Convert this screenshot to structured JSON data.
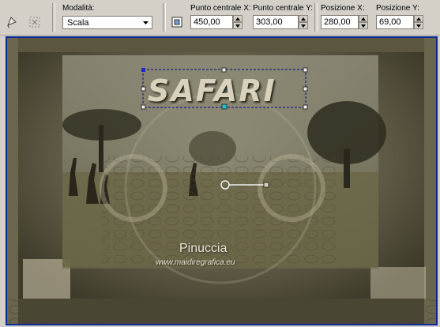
{
  "toolbar": {
    "mode_label": "Modalità:",
    "mode_value": "Scala",
    "center_x_label": "Punto centrale X:",
    "center_x_value": "450,00",
    "center_y_label": "Punto centrale Y:",
    "center_y_value": "303,00",
    "pos_x_label": "Posizione X:",
    "pos_x_value": "280,00",
    "pos_y_label": "Posizione Y:",
    "pos_y_value": "69,00",
    "icons": [
      "lasso-pick-icon",
      "transform-pick-icon",
      "align-icon"
    ]
  },
  "canvas": {
    "banner_text": "SAFARI",
    "signature_name": "Pinuccia",
    "signature_url": "www.maidiregrafica.eu"
  },
  "colors": {
    "selection_border": "#0a2a9c",
    "handle_color": "#20c0c8",
    "toolbar_bg": "#d4d0c8"
  }
}
